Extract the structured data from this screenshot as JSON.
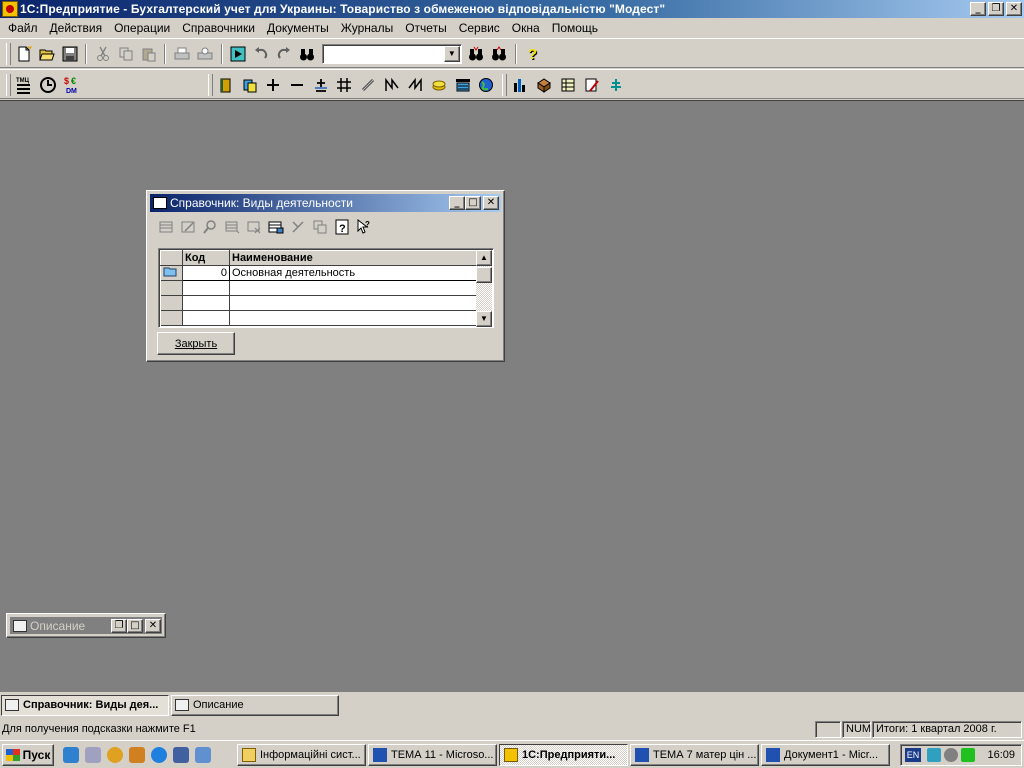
{
  "window": {
    "title": "1С:Предприятие - Бухгалтерский учет для Украины: Товариство з обмеженою відповідальністю \"Модест\""
  },
  "menu": [
    "Файл",
    "Действия",
    "Операции",
    "Справочники",
    "Документы",
    "Журналы",
    "Отчеты",
    "Сервис",
    "Окна",
    "Помощь"
  ],
  "toolbar": {
    "search_value": ""
  },
  "icons": {
    "tmc_label": "ТМЦ",
    "dm_label": "DM"
  },
  "child_window": {
    "title": "Справочник: Виды деятельности",
    "columns": [
      "Код",
      "Наименование"
    ],
    "rows": [
      {
        "code": "0",
        "name": "Основная деятельность"
      },
      {
        "code": "",
        "name": ""
      },
      {
        "code": "",
        "name": ""
      },
      {
        "code": "",
        "name": ""
      }
    ],
    "close_label": "Закрыть"
  },
  "minimized_window": {
    "title": "Описание"
  },
  "window_tabs": [
    {
      "label": "Справочник: Виды дея...",
      "active": true
    },
    {
      "label": "Описание",
      "active": false
    }
  ],
  "status": {
    "hint": "Для получения подсказки нажмите F1",
    "num": "NUM",
    "totals": "Итоги: 1 квартал 2008 г."
  },
  "taskbar": {
    "start_label": "Пуск",
    "tasks": [
      {
        "label": "Інформаційні сист...",
        "active": false
      },
      {
        "label": "ТЕМА 11 - Microso...",
        "active": false
      },
      {
        "label": "1С:Предприяти...",
        "active": true
      },
      {
        "label": "ТЕМА 7 матер цін ...",
        "active": false
      },
      {
        "label": "Документ1 - Micr...",
        "active": false
      }
    ],
    "lang": "EN",
    "clock": "16:09"
  },
  "colors": {
    "title_active": "#0a246a",
    "desktop_bg": "#808080",
    "face": "#d4d0c8"
  }
}
